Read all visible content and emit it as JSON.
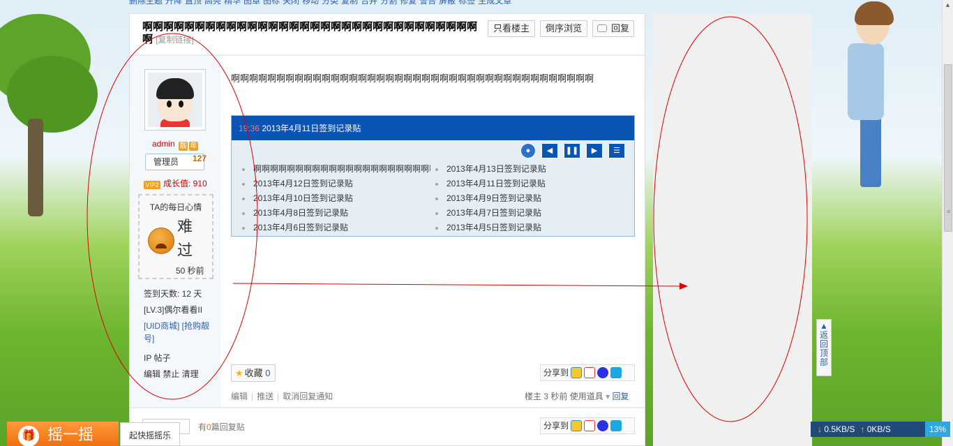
{
  "topnav": {
    "items": [
      "删除主题",
      "升降",
      "置顶",
      "高亮",
      "精华",
      "图章",
      "图标",
      "关闭",
      "移动",
      "分类",
      "复制",
      "合并",
      "分割",
      "修复",
      "警告",
      "屏蔽",
      "标签",
      "生成文章"
    ]
  },
  "post": {
    "title": "啊啊啊啊啊啊啊啊啊啊啊啊啊啊啊啊啊啊啊啊啊啊啊啊啊啊啊啊啊啊啊啊啊",
    "copy_link": "[复制链接]",
    "btn_only_author": "只看楼主",
    "btn_reverse": "倒序浏览",
    "btn_reply": "回复",
    "content": "啊啊啊啊啊啊啊啊啊啊啊啊啊啊啊啊啊啊啊啊啊啊啊啊啊啊啊啊啊啊啊啊啊啊啊啊啊啊啊啊"
  },
  "author": {
    "name": "admin",
    "badge1": "靓",
    "badge2": "年",
    "role": "管理员",
    "role_num": "127",
    "vip": "VIP2",
    "growth": "成长值: 910",
    "mood_title": "TA的每日心情",
    "mood_text": "难过",
    "mood_time": "50 秒前",
    "checkin_days": "签到天数: 12 天",
    "level": "[LV.3]偶尔看看II",
    "links": "[UID商城] [抢购靓号]",
    "ip_line": "IP 帖子",
    "actions": "编辑 禁止 清理"
  },
  "checkin": {
    "time": "19:36",
    "title": "2013年4月11日签到记录贴",
    "col1": [
      "啊啊啊啊啊啊啊啊啊啊啊啊啊啊啊啊啊啊啊啊啊啊",
      "2013年4月12日签到记录贴",
      "2013年4月10日签到记录贴",
      "2013年4月8日签到记录贴",
      "2013年4月6日签到记录贴"
    ],
    "col2": [
      "2013年4月13日签到记录贴",
      "2013年4月11日签到记录贴",
      "2013年4月9日签到记录贴",
      "2013年4月7日签到记录贴",
      "2013年4月5日签到记录贴"
    ]
  },
  "bottom": {
    "collect": "收藏",
    "collect_count": "0",
    "share": "分享到",
    "edit": "编辑",
    "push": "推送",
    "cancel_notify": "取消回复通知",
    "floor": "楼主",
    "time": "3 秒前",
    "use_tool": "使用道具",
    "reply": "回复",
    "footer_prefix": "有",
    "footer_zero": "0",
    "footer_suffix": "篇回复贴"
  },
  "side": {
    "back_top": "返回顶部"
  },
  "shake": {
    "label": "摇一摇",
    "tip": "起快摇摇乐"
  },
  "speed": {
    "down": "0.5KB/S",
    "up": "0KB/S",
    "pct": "13%"
  },
  "colors": {
    "accent": "#0a54b3",
    "link": "#2e5fa8",
    "alert": "#c00"
  }
}
